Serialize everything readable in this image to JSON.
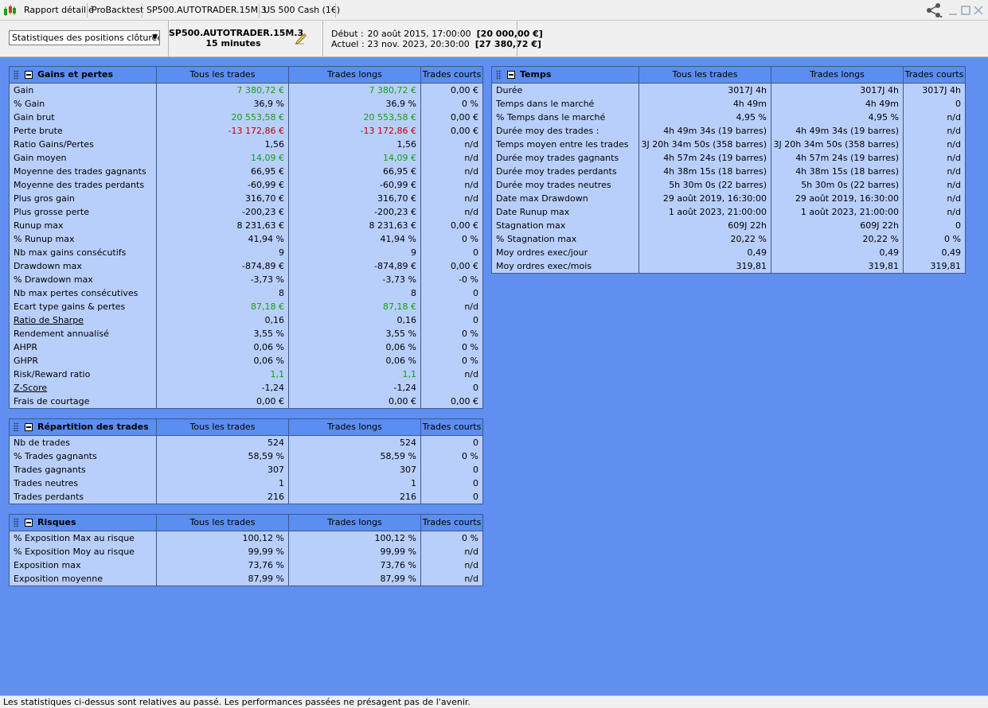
{
  "titlebar": {
    "tabs": [
      "Rapport détaillé",
      "ProBacktest",
      "SP500.AUTOTRADER.15M.3",
      "US 500 Cash (1€)"
    ]
  },
  "toolbar": {
    "select_value": "Statistiques des positions clôturées",
    "instrument": "SP500.AUTOTRADER.15M.3",
    "timeframe": "15 minutes",
    "start_label": "Début :",
    "start_value": "20 août 2015, 17:00:00",
    "start_capital": "[20 000,00 €]",
    "end_label": "Actuel :",
    "end_value": "23 nov. 2023, 20:30:00",
    "end_capital": "[27 380,72 €]"
  },
  "columns": [
    "Tous les trades",
    "Trades longs",
    "Trades courts"
  ],
  "panels": {
    "gains": {
      "title": "Gains et pertes",
      "rows": [
        [
          "Gain",
          "7 380,72 €",
          "7 380,72 €",
          "0,00 €"
        ],
        [
          "% Gain",
          "36,9 %",
          "36,9 %",
          "0 %"
        ],
        [
          "Gain brut",
          "20 553,58 €",
          "20 553,58 €",
          "0,00 €"
        ],
        [
          "Perte brute",
          "-13 172,86 €",
          "-13 172,86 €",
          "0,00 €"
        ],
        [
          "Ratio Gains/Pertes",
          "1,56",
          "1,56",
          "n/d"
        ],
        [
          "Gain moyen",
          "14,09 €",
          "14,09 €",
          "n/d"
        ],
        [
          "Moyenne des trades gagnants",
          "66,95 €",
          "66,95 €",
          "n/d"
        ],
        [
          "Moyenne des trades perdants",
          "-60,99 €",
          "-60,99 €",
          "n/d"
        ],
        [
          "Plus gros gain",
          "316,70 €",
          "316,70 €",
          "n/d"
        ],
        [
          "Plus grosse perte",
          "-200,23 €",
          "-200,23 €",
          "n/d"
        ],
        [
          "Runup max",
          "8 231,63 €",
          "8 231,63 €",
          "0,00 €"
        ],
        [
          "% Runup max",
          "41,94 %",
          "41,94 %",
          "0 %"
        ],
        [
          "Nb max gains consécutifs",
          "9",
          "9",
          "0"
        ],
        [
          "Drawdown max",
          "-874,89 €",
          "-874,89 €",
          "0,00 €"
        ],
        [
          "% Drawdown max",
          "-3,73 %",
          "-3,73 %",
          "-0 %"
        ],
        [
          "Nb max pertes consécutives",
          "8",
          "8",
          "0"
        ],
        [
          "Ecart type gains & pertes",
          "87,18 €",
          "87,18 €",
          "n/d"
        ],
        [
          "Ratio de Sharpe",
          "0,16",
          "0,16",
          "0"
        ],
        [
          "Rendement annualisé",
          "3,55 %",
          "3,55 %",
          "0 %"
        ],
        [
          "AHPR",
          "0,06 %",
          "0,06 %",
          "0 %"
        ],
        [
          "GHPR",
          "0,06 %",
          "0,06 %",
          "0 %"
        ],
        [
          "Risk/Reward ratio",
          "1,1",
          "1,1",
          "n/d"
        ],
        [
          "Z-Score",
          "-1,24",
          "-1,24",
          "0"
        ],
        [
          "Frais de courtage",
          "0,00 €",
          "0,00 €",
          "0,00 €"
        ]
      ]
    },
    "repartition": {
      "title": "Répartition des trades",
      "rows": [
        [
          "Nb de trades",
          "524",
          "524",
          "0"
        ],
        [
          "% Trades gagnants",
          "58,59 %",
          "58,59 %",
          "0 %"
        ],
        [
          "Trades gagnants",
          "307",
          "307",
          "0"
        ],
        [
          "Trades neutres",
          "1",
          "1",
          "0"
        ],
        [
          "Trades perdants",
          "216",
          "216",
          "0"
        ]
      ]
    },
    "risques": {
      "title": "Risques",
      "rows": [
        [
          "% Exposition Max au risque",
          "100,12 %",
          "100,12 %",
          "0 %"
        ],
        [
          "% Exposition Moy au risque",
          "99,99 %",
          "99,99 %",
          "n/d"
        ],
        [
          "Exposition max",
          "73,76 %",
          "73,76 %",
          "n/d"
        ],
        [
          "Exposition moyenne",
          "87,99 %",
          "87,99 %",
          "n/d"
        ]
      ]
    },
    "temps": {
      "title": "Temps",
      "rows": [
        [
          "Durée",
          "3017J 4h",
          "3017J 4h",
          "3017J 4h"
        ],
        [
          "Temps dans le marché",
          "4h 49m",
          "4h 49m",
          "0"
        ],
        [
          "% Temps dans le marché",
          "4,95 %",
          "4,95 %",
          "n/d"
        ],
        [
          "Durée moy des trades :",
          "4h 49m 34s (19 barres)",
          "4h 49m 34s (19 barres)",
          "n/d"
        ],
        [
          "Temps moyen entre les trades",
          "3J 20h 34m 50s (358 barres)",
          "3J 20h 34m 50s (358 barres)",
          "n/d"
        ],
        [
          "Durée moy trades gagnants",
          "4h 57m 24s (19 barres)",
          "4h 57m 24s (19 barres)",
          "n/d"
        ],
        [
          "Durée moy trades perdants",
          "4h 38m 15s (18 barres)",
          "4h 38m 15s (18 barres)",
          "n/d"
        ],
        [
          "Durée moy trades neutres",
          "5h 30m 0s (22 barres)",
          "5h 30m 0s (22 barres)",
          "n/d"
        ],
        [
          "Date max Drawdown",
          "29 août 2019, 16:30:00",
          "29 août 2019, 16:30:00",
          "n/d"
        ],
        [
          "Date Runup max",
          "1 août 2023, 21:00:00",
          "1 août 2023, 21:00:00",
          "n/d"
        ],
        [
          "Stagnation max",
          "609J 22h",
          "609J 22h",
          "0"
        ],
        [
          "% Stagnation max",
          "20,22 %",
          "20,22 %",
          "0 %"
        ],
        [
          "Moy ordres exec/jour",
          "0,49",
          "0,49",
          "0,49"
        ],
        [
          "Moy ordres exec/mois",
          "319,81",
          "319,81",
          "319,81"
        ]
      ]
    }
  },
  "status": "Les statistiques ci-dessus sont relatives au passé. Les performances passées ne présagent pas de l'avenir.",
  "colors": {
    "background": "#5f8ff0",
    "panel": "#b9cffb",
    "header": "#5c8df0",
    "positive": "#11a011",
    "negative": "#c00000"
  }
}
